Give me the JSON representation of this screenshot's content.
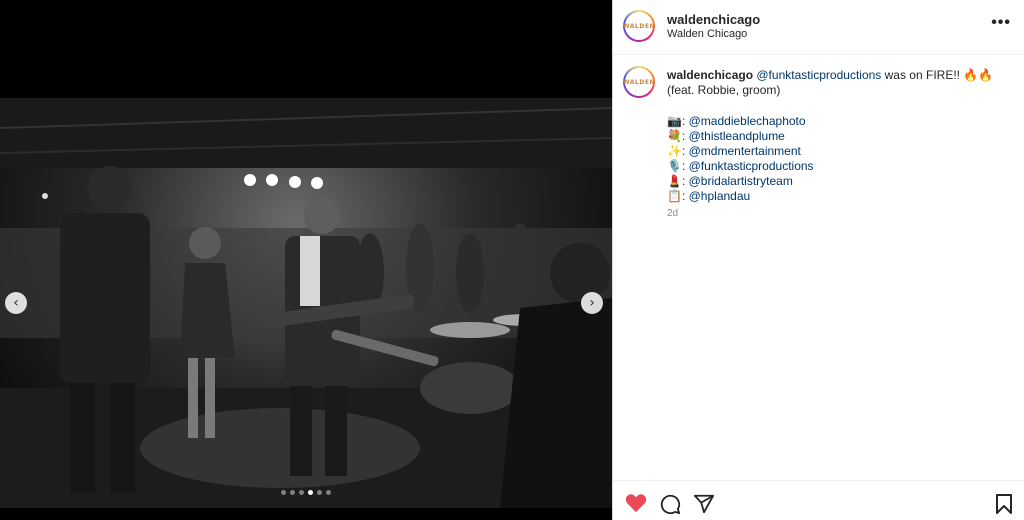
{
  "media": {
    "prev_icon": "‹",
    "next_icon": "›",
    "dots": [
      false,
      false,
      false,
      true,
      false,
      false
    ]
  },
  "header": {
    "username": "waldenchicago",
    "subtitle": "Walden Chicago",
    "avatar_text": "WALDEN",
    "more_icon": "•••"
  },
  "caption": {
    "username": "waldenchicago",
    "mention": "@funktasticproductions",
    "text_after": " was on FIRE!! 🔥🔥",
    "line2": "(feat. Robbie, groom)",
    "credits": [
      {
        "emoji": "📷",
        "handle": "@maddieblechaphoto"
      },
      {
        "emoji": "💐",
        "handle": "@thistleandplume"
      },
      {
        "emoji": "✨",
        "handle": "@mdmentertainment"
      },
      {
        "emoji": "🎙️",
        "handle": "@funktasticproductions"
      },
      {
        "emoji": "💄",
        "handle": "@bridalartistryteam"
      },
      {
        "emoji": "📋",
        "handle": "@hplandau"
      }
    ],
    "timestamp": "2d"
  },
  "colors": {
    "like": "#ed4956",
    "text": "#262626",
    "link": "#00376b"
  }
}
